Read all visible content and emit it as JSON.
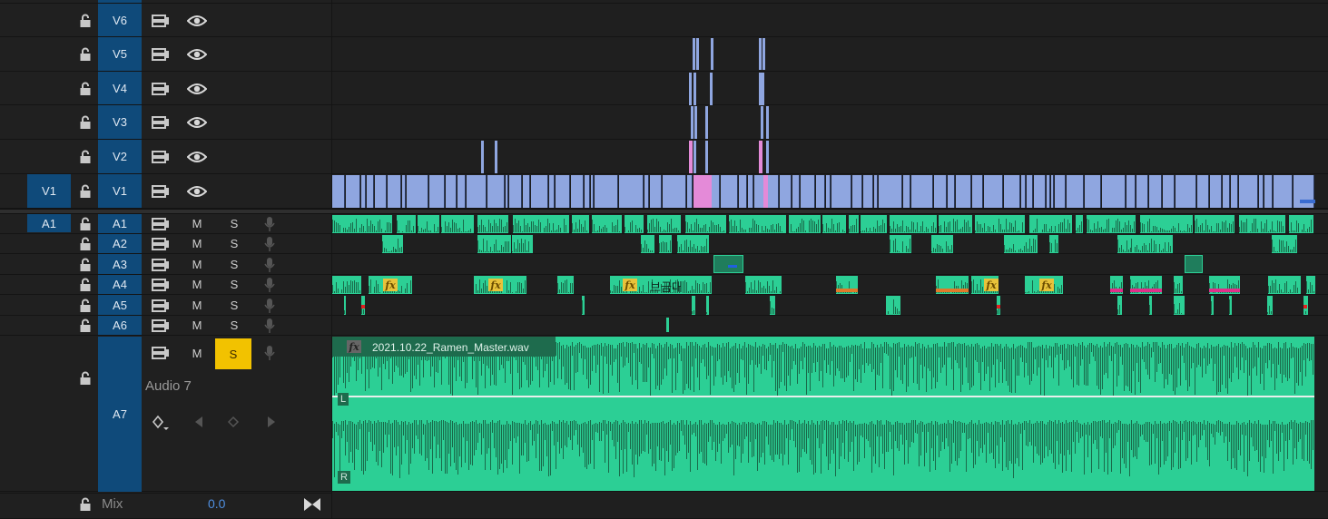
{
  "video_tracks": [
    {
      "name": "V6"
    },
    {
      "name": "V5"
    },
    {
      "name": "V4"
    },
    {
      "name": "V3"
    },
    {
      "name": "V2"
    },
    {
      "name": "V1",
      "source": "V1"
    }
  ],
  "audio_tracks": [
    {
      "name": "A1",
      "source": "A1",
      "mute": "M",
      "solo": "S"
    },
    {
      "name": "A2",
      "mute": "M",
      "solo": "S"
    },
    {
      "name": "A3",
      "mute": "M",
      "solo": "S"
    },
    {
      "name": "A4",
      "mute": "M",
      "solo": "S"
    },
    {
      "name": "A5",
      "mute": "M",
      "solo": "S"
    },
    {
      "name": "A6",
      "mute": "M",
      "solo": "S"
    }
  ],
  "a7": {
    "name": "A7",
    "label": "Audio 7",
    "mute": "M",
    "solo": "S",
    "solo_active": true,
    "clip_name": "2021.10.22_Ramen_Master.wav",
    "channel_left": "L",
    "channel_right": "R",
    "fx_glyph": "fx"
  },
  "a4_clip_label": "브금대",
  "fx_glyph": "fx",
  "mix": {
    "label": "Mix",
    "value": "0.0"
  },
  "colors": {
    "video_clip": "#8fa6e0",
    "video_pink": "#e48ad8",
    "audio_clip": "#2ccf95",
    "audio_wave_dark": "#1a6a4a",
    "fx_badge": "#e8c23a",
    "track_blue": "#0f4a7a",
    "solo_on": "#f2c200",
    "mix_value": "#4f8fe0"
  },
  "icons": [
    "lock-icon",
    "sync-icon",
    "eye-icon",
    "mic-icon",
    "keyframe-icon",
    "prev-keyframe-icon",
    "next-keyframe-icon",
    "mix-end-icon"
  ]
}
